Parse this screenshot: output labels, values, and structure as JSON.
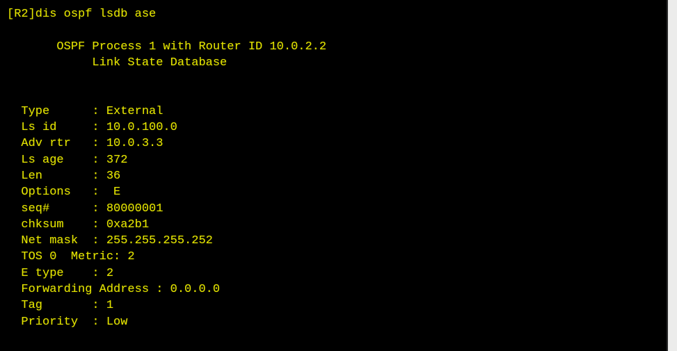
{
  "terminal": {
    "prompt_line": "[R2]dis ospf lsdb ase",
    "prompt_device": "[R2]",
    "command": "dis ospf lsdb ase",
    "blank_1": " ",
    "header_title": "       OSPF Process 1 with Router ID 10.0.2.2",
    "header_subtitle": "            Link State Database",
    "blank_2": " ",
    "blank_3": " ",
    "ospf": {
      "process_id": "1",
      "router_id": "10.0.2.2",
      "database_name": "Link State Database"
    },
    "lsa_lines": [
      "  Type      : External",
      "  Ls id     : 10.0.100.0",
      "  Adv rtr   : 10.0.3.3",
      "  Ls age    : 372",
      "  Len       : 36",
      "  Options   :  E",
      "  seq#      : 80000001",
      "  chksum    : 0xa2b1",
      "  Net mask  : 255.255.255.252",
      "  TOS 0  Metric: 2",
      "  E type    : 2",
      "  Forwarding Address : 0.0.0.0",
      "  Tag       : 1",
      "  Priority  : Low"
    ],
    "lsa_fields": [
      {
        "label": "Type",
        "value": "External"
      },
      {
        "label": "Ls id",
        "value": "10.0.100.0"
      },
      {
        "label": "Adv rtr",
        "value": "10.0.3.3"
      },
      {
        "label": "Ls age",
        "value": "372"
      },
      {
        "label": "Len",
        "value": "36"
      },
      {
        "label": "Options",
        "value": "E"
      },
      {
        "label": "seq#",
        "value": "80000001"
      },
      {
        "label": "chksum",
        "value": "0xa2b1"
      },
      {
        "label": "Net mask",
        "value": "255.255.255.252"
      },
      {
        "label": "TOS 0",
        "value": "Metric: 2"
      },
      {
        "label": "E type",
        "value": "2"
      },
      {
        "label": "Forwarding Address",
        "value": "0.0.0.0"
      },
      {
        "label": "Tag",
        "value": "1"
      },
      {
        "label": "Priority",
        "value": "Low"
      }
    ]
  },
  "colors": {
    "background": "#000000",
    "text": "#e3e300",
    "window_border": "#ececeb"
  }
}
